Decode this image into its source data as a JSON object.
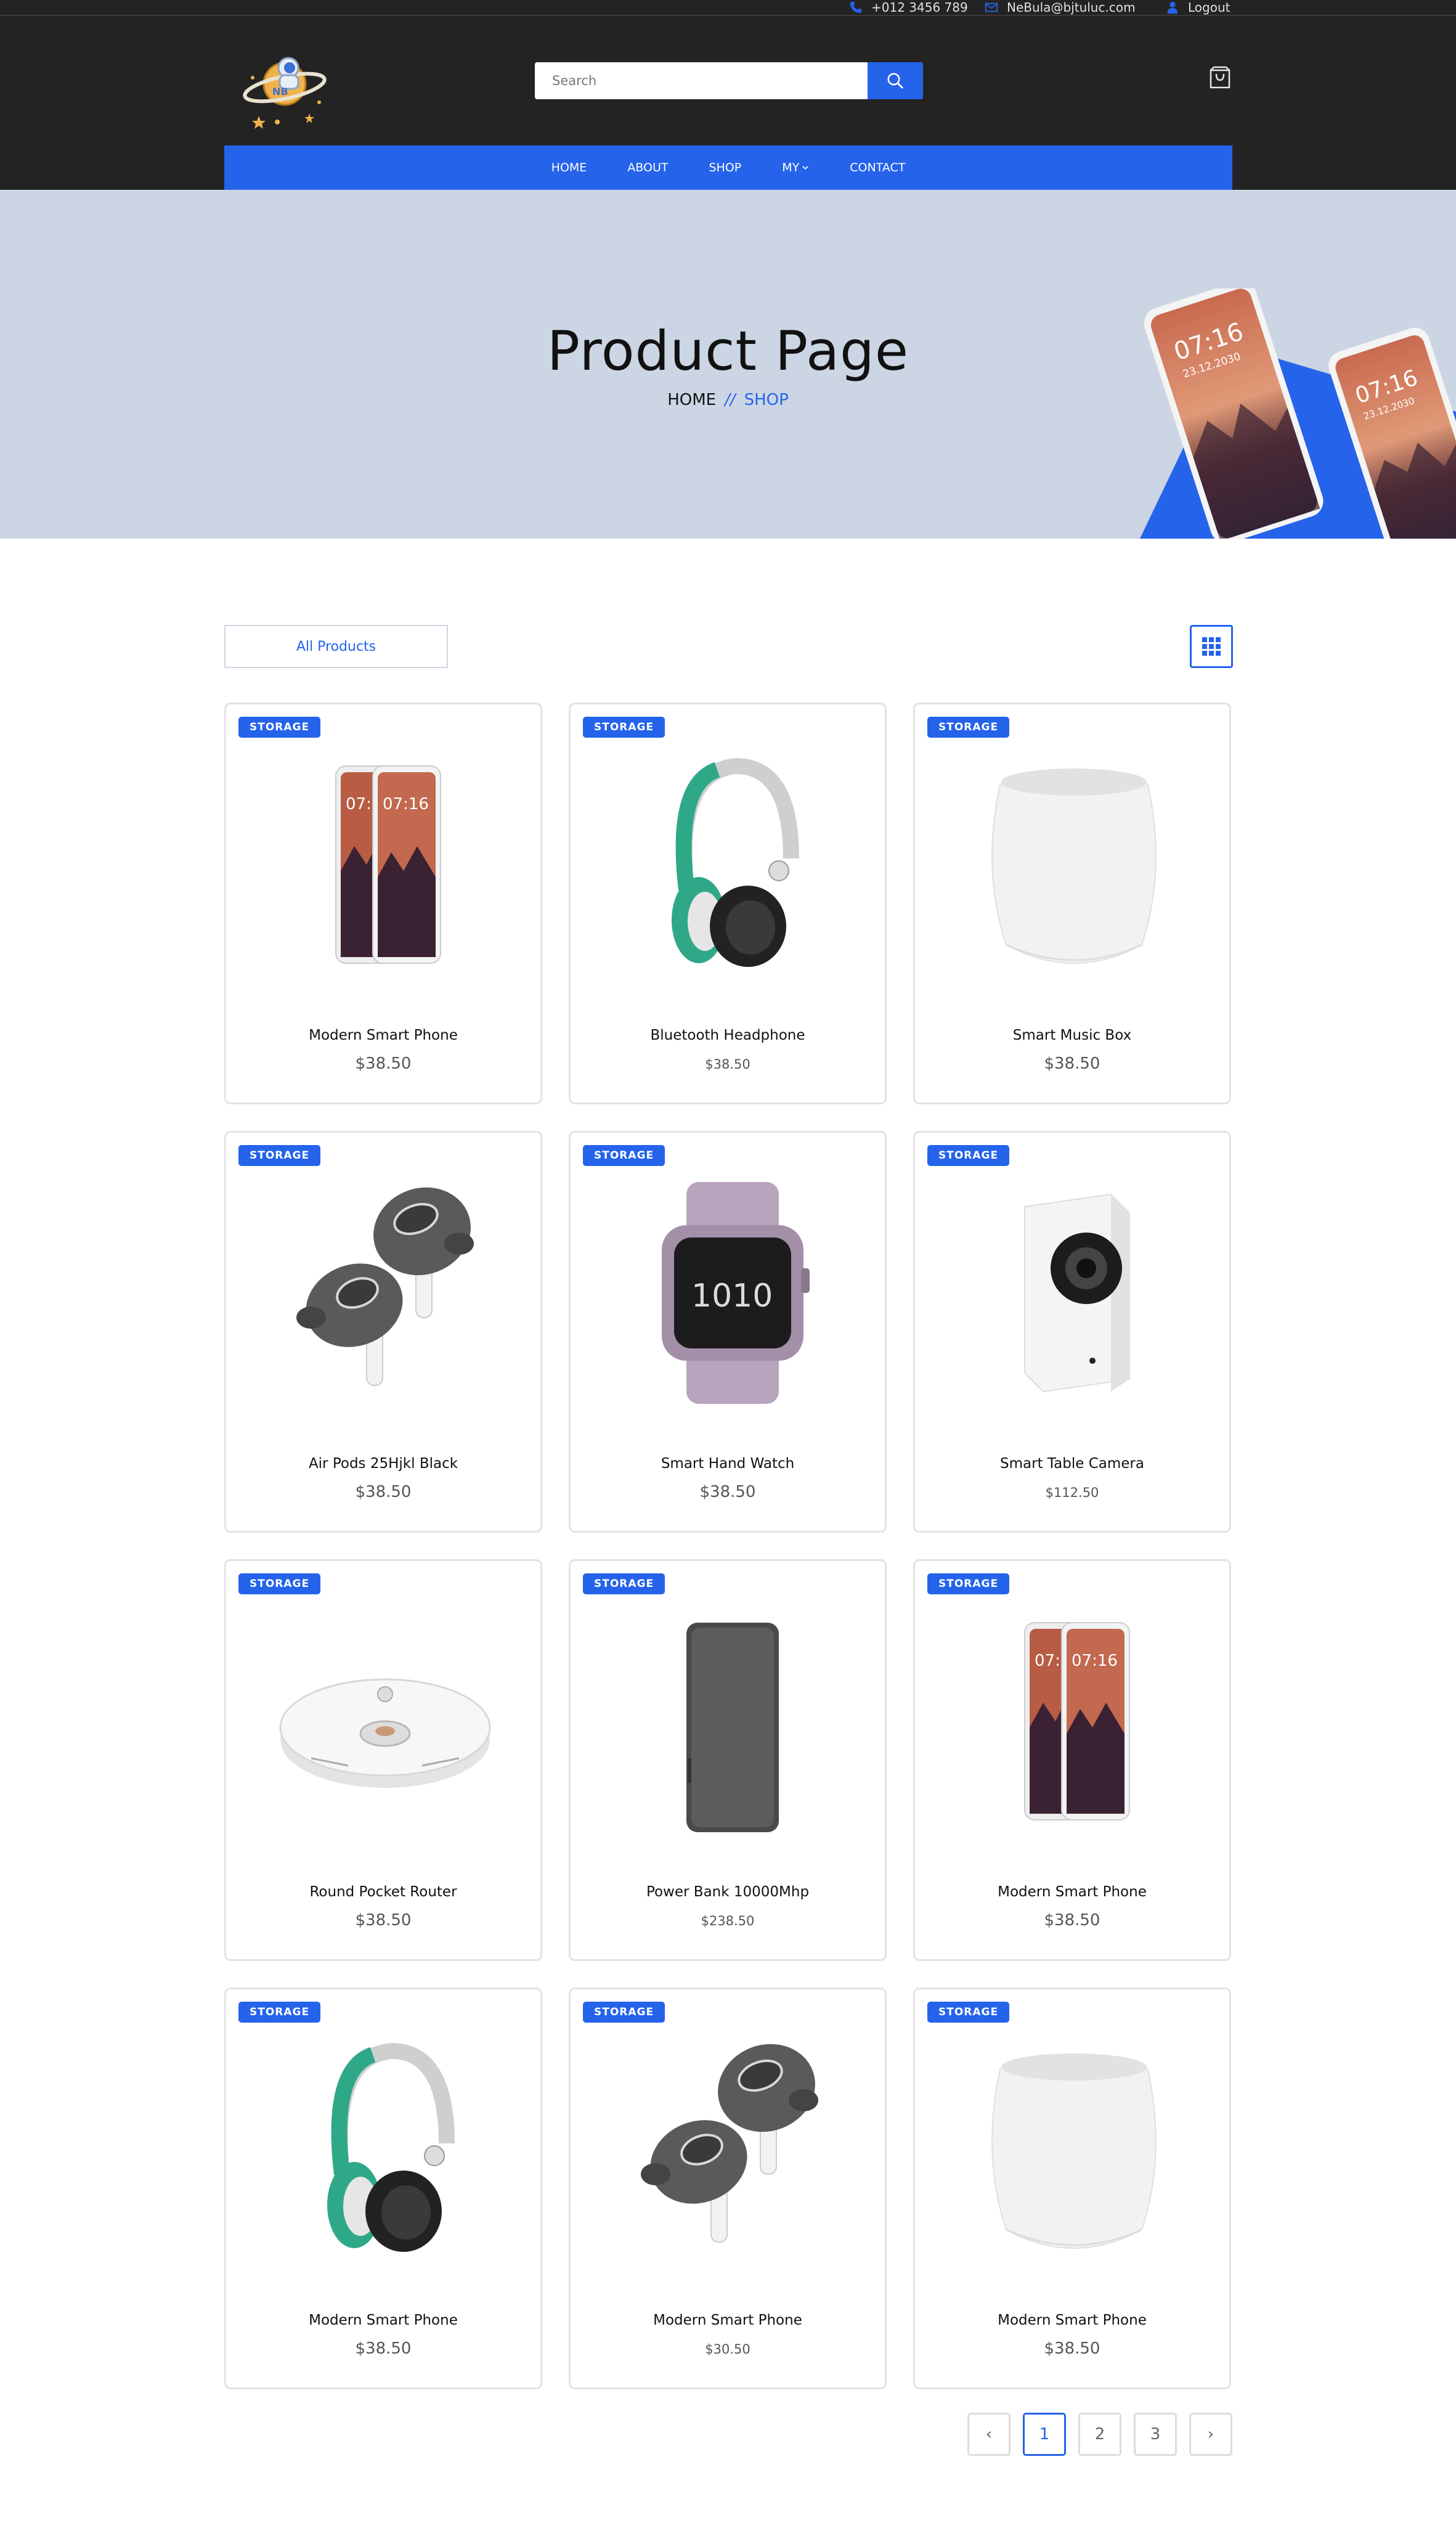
{
  "topbar": {
    "phone": "+012 3456 789",
    "email": "NeBula@bjtuluc.com",
    "logout": "Logout"
  },
  "header": {
    "search_placeholder": "Search"
  },
  "nav": [
    {
      "label": "HOME"
    },
    {
      "label": "ABOUT"
    },
    {
      "label": "SHOP"
    },
    {
      "label": "MY"
    },
    {
      "label": "CONTACT"
    }
  ],
  "hero": {
    "title": "Product Page",
    "breadcrumb_home": "HOME",
    "breadcrumb_sep": "//",
    "breadcrumb_current": "SHOP",
    "phone_time": "07:16",
    "phone_date": "23.12.2030"
  },
  "filter": {
    "label": "All Products"
  },
  "products": [
    {
      "badge": "STORAGE",
      "name": "Modern Smart Phone",
      "price": "$38.50",
      "image": "phones"
    },
    {
      "badge": "STORAGE",
      "name": "Bluetooth Headphone",
      "price": "$38.50",
      "image": "headphone"
    },
    {
      "badge": "STORAGE",
      "name": "Smart Music Box",
      "price": "$38.50",
      "image": "speaker"
    },
    {
      "badge": "STORAGE",
      "name": "Air Pods 25Hjkl Black",
      "price": "$38.50",
      "image": "earbuds"
    },
    {
      "badge": "STORAGE",
      "name": "Smart Hand Watch",
      "price": "$38.50",
      "image": "watch"
    },
    {
      "badge": "STORAGE",
      "name": "Smart Table Camera",
      "price": "$112.50",
      "image": "camera"
    },
    {
      "badge": "STORAGE",
      "name": "Round Pocket Router",
      "price": "$38.50",
      "image": "robot"
    },
    {
      "badge": "STORAGE",
      "name": "Power Bank 10000Mhp",
      "price": "$238.50",
      "image": "powerbank"
    },
    {
      "badge": "STORAGE",
      "name": "Modern Smart Phone",
      "price": "$38.50",
      "image": "phones"
    },
    {
      "badge": "STORAGE",
      "name": "Modern Smart Phone",
      "price": "$38.50",
      "image": "headphone"
    },
    {
      "badge": "STORAGE",
      "name": "Modern Smart Phone",
      "price": "$30.50",
      "image": "earbuds"
    },
    {
      "badge": "STORAGE",
      "name": "Modern Smart Phone",
      "price": "$38.50",
      "image": "speaker"
    }
  ],
  "pagination": {
    "prev": "‹",
    "pages": [
      "1",
      "2",
      "3"
    ],
    "current": "1",
    "next": "›"
  },
  "colors": {
    "accent": "#2563eb",
    "header_bg": "#232323",
    "hero_bg": "#ccd5e3"
  }
}
